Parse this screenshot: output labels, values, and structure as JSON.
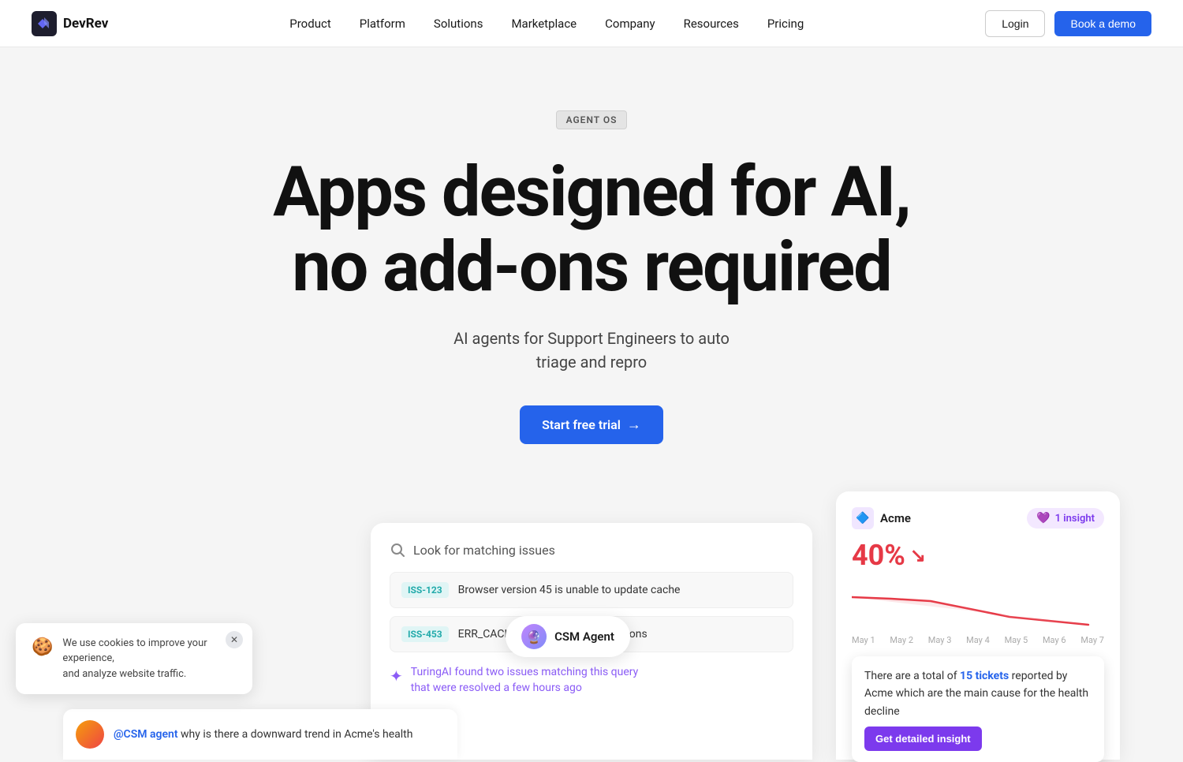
{
  "brand": {
    "name": "DevRev",
    "logo_text": "DevRev"
  },
  "nav": {
    "links": [
      {
        "label": "Product",
        "id": "product"
      },
      {
        "label": "Platform",
        "id": "platform"
      },
      {
        "label": "Solutions",
        "id": "solutions"
      },
      {
        "label": "Marketplace",
        "id": "marketplace"
      },
      {
        "label": "Company",
        "id": "company"
      },
      {
        "label": "Resources",
        "id": "resources"
      },
      {
        "label": "Pricing",
        "id": "pricing"
      }
    ],
    "login_label": "Login",
    "demo_label": "Book a demo"
  },
  "hero": {
    "badge": "AGENT OS",
    "title_line1": "Apps designed for AI,",
    "title_line2": "no add-ons required",
    "subtitle": "AI agents for Support Engineers to auto\ntriage and repro",
    "cta_label": "Start free trial",
    "cta_arrow": "→"
  },
  "left_panel": {
    "search_label": "Look for matching issues",
    "issues": [
      {
        "badge": "ISS-123",
        "text": "Browser version 45 is unable to update cache"
      },
      {
        "badge": "ISS-453",
        "text": "ERR_CACHE_MISS in browser versions"
      }
    ],
    "ai_text_line1": "TuringAI found two issues matching this query",
    "ai_text_line2": "that were resolved a few hours ago"
  },
  "middle_agent": {
    "label": "CSM Agent"
  },
  "right_panel": {
    "company_name": "Acme",
    "insight_label": "1 insight",
    "percent": "40%",
    "percent_arrow": "↘",
    "tooltip": {
      "prefix": "There are a total of ",
      "highlight": "15 tickets",
      "suffix": " reported by Acme which are the main cause for the health decline"
    },
    "insight_button": "Get detailed insight",
    "chart_dates": [
      "May 1",
      "May 2",
      "May 3",
      "May 4",
      "May 5",
      "May 6",
      "May 7"
    ]
  },
  "chat": {
    "mention": "@CSM agent",
    "text": " why is there a downward trend in Acme's health"
  },
  "cookie": {
    "text_line1": "We use cookies to improve your experience,",
    "text_line2": "and analyze website traffic."
  }
}
